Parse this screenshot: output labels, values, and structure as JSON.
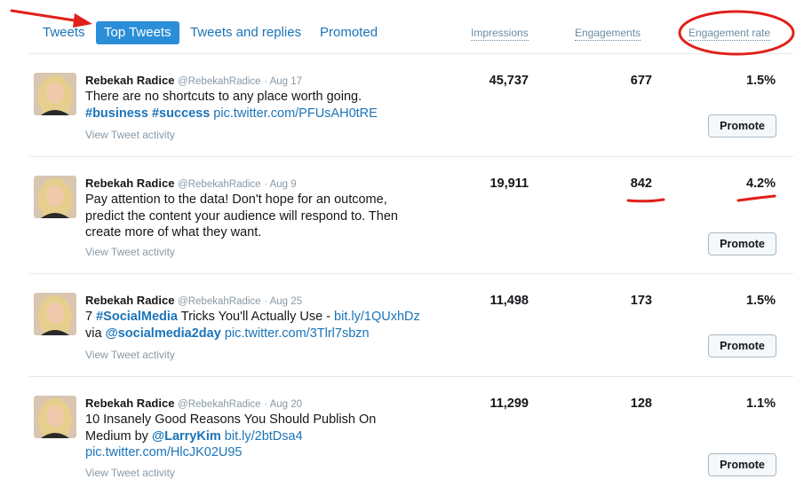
{
  "tabs": [
    {
      "label": "Tweets",
      "active": false
    },
    {
      "label": "Top Tweets",
      "active": true
    },
    {
      "label": "Tweets and replies",
      "active": false
    },
    {
      "label": "Promoted",
      "active": false
    }
  ],
  "columns": {
    "impressions": "Impressions",
    "engagements": "Engagements",
    "engagement_rate": "Engagement rate"
  },
  "colors": {
    "accent": "#1b74b8",
    "active_tab": "#2b8ed8",
    "annotation": "#e0201a"
  },
  "tweets": [
    {
      "name": "Rebekah Radice",
      "handle": "@RebekahRadice",
      "date": "· Aug 17",
      "text_plain": "There are no shortcuts to any place worth going.",
      "hashtags": "#business #success",
      "link": "pic.twitter.com/PFUsAH0tRE",
      "impressions": "45,737",
      "engagements": "677",
      "engagement_rate": "1.5%",
      "activity": "View Tweet activity",
      "promote": "Promote"
    },
    {
      "name": "Rebekah Radice",
      "handle": "@RebekahRadice",
      "date": "· Aug 9",
      "line1": "Pay attention to the data! Don't hope for an outcome,",
      "line2": "predict the content your audience will respond to. Then",
      "line3": "create more of what they want.",
      "impressions": "19,911",
      "engagements": "842",
      "engagement_rate": "4.2%",
      "activity": "View Tweet activity",
      "promote": "Promote"
    },
    {
      "name": "Rebekah Radice",
      "handle": "@RebekahRadice",
      "date": "· Aug 25",
      "pre": "7",
      "hashtag": "#SocialMedia",
      "mid": "Tricks You'll Actually Use -",
      "link1": "bit.ly/1QUxhDz",
      "via": "via",
      "mention": "@socialmedia2day",
      "link2": "pic.twitter.com/3Tlrl7sbzn",
      "impressions": "11,498",
      "engagements": "173",
      "engagement_rate": "1.5%",
      "activity": "View Tweet activity",
      "promote": "Promote"
    },
    {
      "name": "Rebekah Radice",
      "handle": "@RebekahRadice",
      "date": "· Aug 20",
      "line1": "10 Insanely Good Reasons You Should Publish On",
      "line2_pre": "Medium by",
      "mention": "@LarryKim",
      "link1": "bit.ly/2btDsa4",
      "link2": "pic.twitter.com/HlcJK02U95",
      "impressions": "11,299",
      "engagements": "128",
      "engagement_rate": "1.1%",
      "activity": "View Tweet activity",
      "promote": "Promote"
    }
  ]
}
